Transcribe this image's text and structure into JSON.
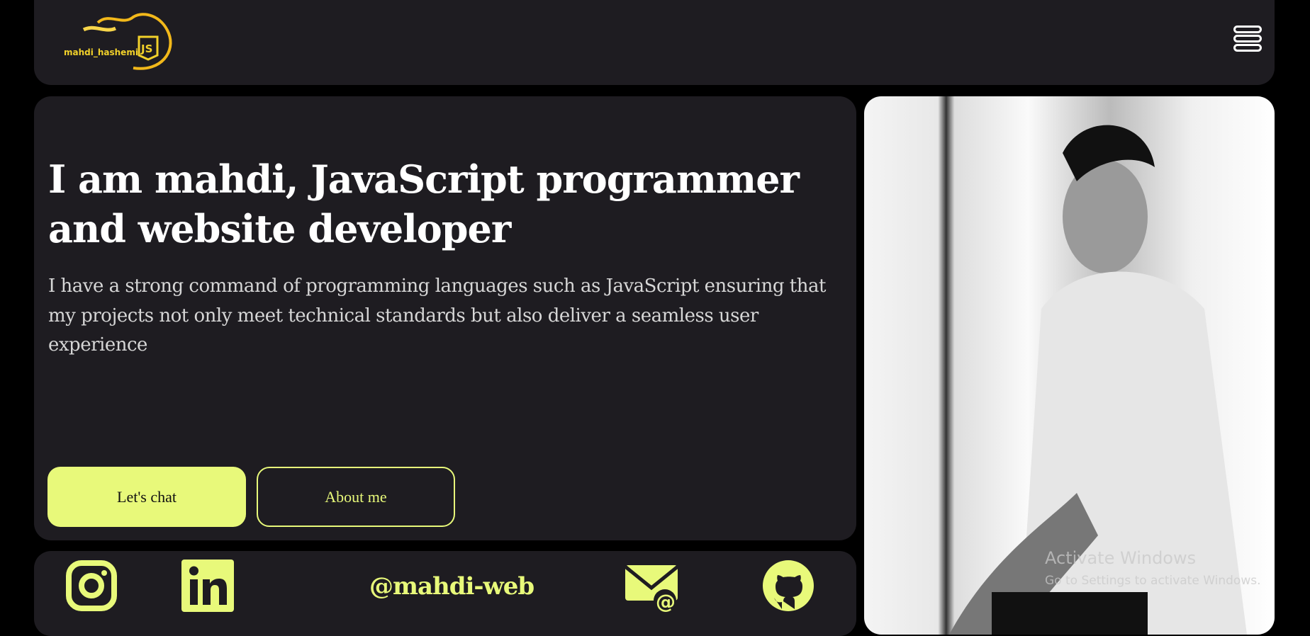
{
  "header": {
    "logo_text": "mahdi_hashemi",
    "logo_badge": "JS",
    "menu_icon": "hamburger-icon"
  },
  "hero": {
    "title": "I am mahdi, JavaScript programmer and website developer",
    "description": "I have a strong command of programming languages such as JavaScript ensuring that my projects not only meet technical standards but also deliver a seamless user experience",
    "buttons": {
      "chat": "Let's chat",
      "about": "About me"
    }
  },
  "social": {
    "handle": "@mahdi-web",
    "icons": [
      "instagram-icon",
      "linkedin-icon",
      "email-icon",
      "github-icon"
    ]
  },
  "watermark": {
    "line1": "Activate Windows",
    "line2": "Go to Settings to activate Windows."
  },
  "colors": {
    "accent": "#e8f97a",
    "card": "#1e1c21",
    "background": "#000000",
    "logo": "#f2d12a"
  }
}
